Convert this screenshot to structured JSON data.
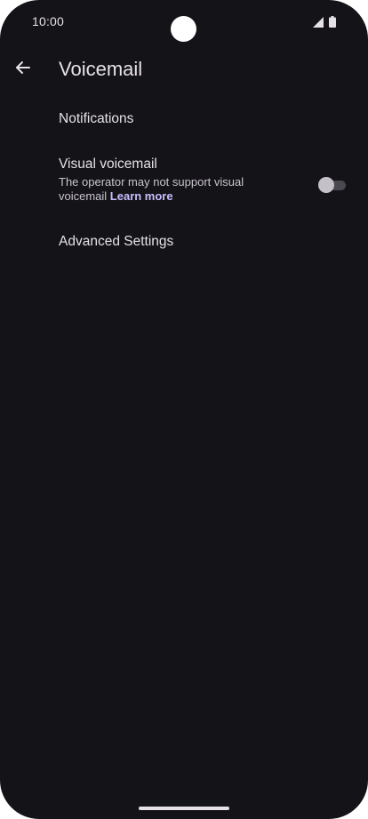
{
  "status_bar": {
    "time": "10:00",
    "icons": [
      "signal-icon",
      "battery-icon"
    ]
  },
  "header": {
    "title": "Voicemail",
    "back_icon": "arrow-back-icon"
  },
  "settings": {
    "notifications": {
      "title": "Notifications"
    },
    "visual_voicemail": {
      "title": "Visual voicemail",
      "summary": "The operator may not support visual voicemail",
      "link": "Learn more",
      "enabled": false
    },
    "advanced": {
      "title": "Advanced Settings"
    }
  },
  "colors": {
    "background": "#141318",
    "text_primary": "#e6e1e6",
    "text_secondary": "#c9c4cd",
    "link": "#c7bfff"
  }
}
